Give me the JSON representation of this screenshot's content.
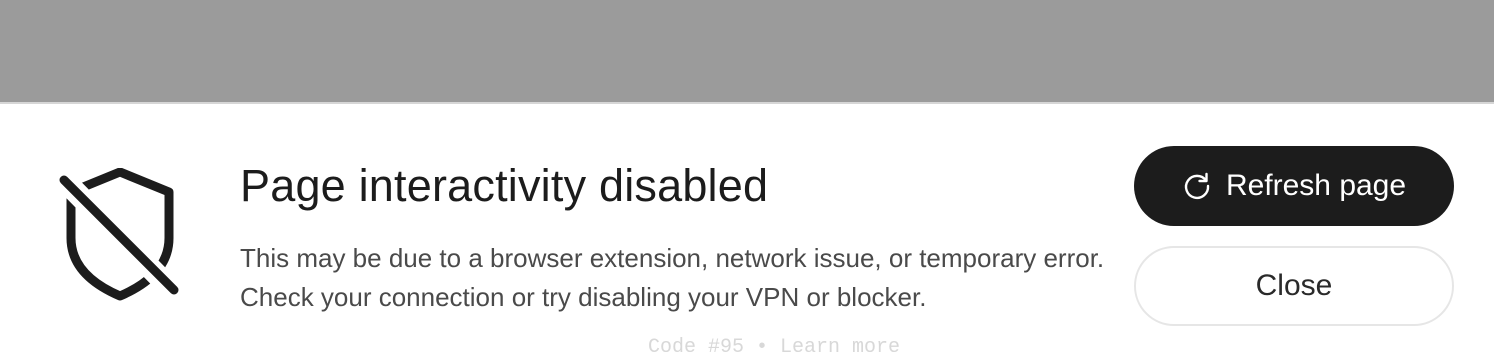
{
  "dialog": {
    "title": "Page interactivity disabled",
    "message": "This may be due to a browser extension, network issue, or temporary error. Check your connection or try disabling your VPN or blocker.",
    "icon": "shield-off-icon"
  },
  "actions": {
    "refresh_label": "Refresh page",
    "refresh_icon": "refresh-icon",
    "close_label": "Close"
  },
  "footer": {
    "code": "Code #95",
    "separator": "•",
    "learn_more": "Learn more"
  },
  "colors": {
    "backdrop": "#9b9b9b",
    "primary_button": "#1c1c1c",
    "text": "#1c1c1c"
  }
}
